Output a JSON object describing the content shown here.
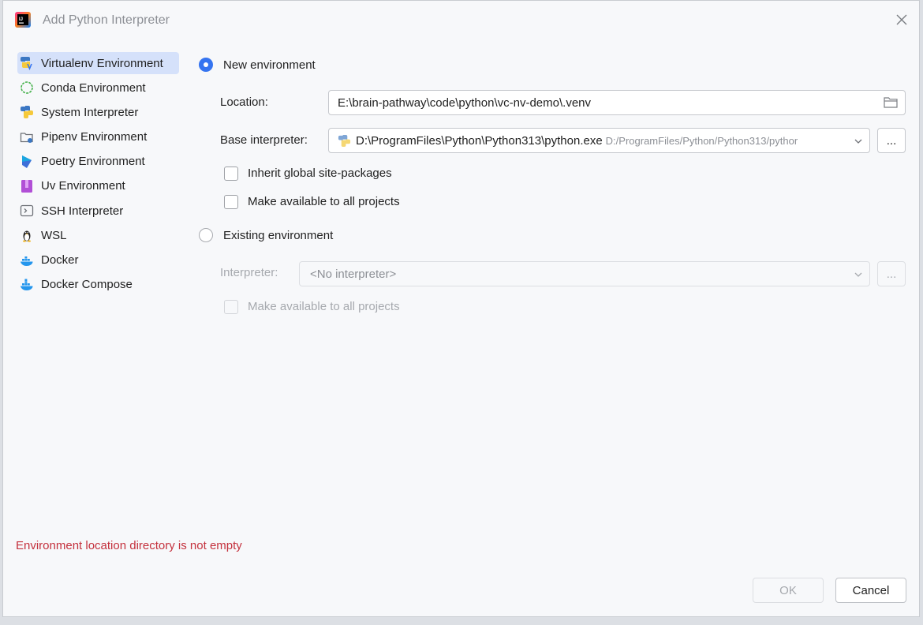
{
  "window": {
    "title": "Add Python Interpreter"
  },
  "sidebar": {
    "items": [
      {
        "label": "Virtualenv Environment",
        "icon": "virtualenv-icon"
      },
      {
        "label": "Conda Environment",
        "icon": "conda-icon"
      },
      {
        "label": "System Interpreter",
        "icon": "python-icon"
      },
      {
        "label": "Pipenv Environment",
        "icon": "pipenv-icon"
      },
      {
        "label": "Poetry Environment",
        "icon": "poetry-icon"
      },
      {
        "label": "Uv Environment",
        "icon": "uv-icon"
      },
      {
        "label": "SSH Interpreter",
        "icon": "ssh-icon"
      },
      {
        "label": "WSL",
        "icon": "linux-penguin-icon"
      },
      {
        "label": "Docker",
        "icon": "docker-icon"
      },
      {
        "label": "Docker Compose",
        "icon": "docker-compose-icon"
      }
    ],
    "selected": "Virtualenv Environment"
  },
  "new_env": {
    "label": "New environment",
    "location_label": "Location:",
    "location_value": "E:\\brain-pathway\\code\\python\\vc-nv-demo\\.venv",
    "base_label": "Base interpreter:",
    "base_value": "D:\\ProgramFiles\\Python\\Python313\\python.exe",
    "base_hint": "D:/ProgramFiles/Python/Python313/pythor",
    "browse_label": "...",
    "inherit_label": "Inherit global site-packages",
    "make_available_label": "Make available to all projects"
  },
  "existing_env": {
    "label": "Existing environment",
    "interpreter_label": "Interpreter:",
    "interpreter_value": "<No interpreter>",
    "browse_label": "...",
    "make_available_label": "Make available to all projects"
  },
  "error_message": "Environment location directory is not empty",
  "buttons": {
    "ok": "OK",
    "cancel": "Cancel"
  },
  "colors": {
    "accent": "#3574f0",
    "error": "#c4313d",
    "selected_bg": "#d5e1fa"
  }
}
